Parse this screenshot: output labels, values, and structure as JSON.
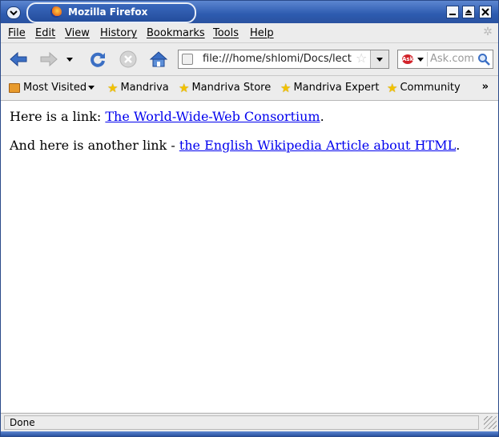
{
  "window": {
    "title": "Mozilla Firefox",
    "accent_color": "#2d5bb0"
  },
  "window_buttons": {
    "minimize_icon": "minimize-icon",
    "maximize_icon": "maximize-icon",
    "close_icon": "close-icon"
  },
  "menubar": {
    "items": [
      {
        "label": "File"
      },
      {
        "label": "Edit"
      },
      {
        "label": "View"
      },
      {
        "label": "History"
      },
      {
        "label": "Bookmarks"
      },
      {
        "label": "Tools"
      },
      {
        "label": "Help"
      }
    ]
  },
  "navbar": {
    "url": "file:///home/shlomi/Docs/lecture",
    "search_placeholder": "Ask.com",
    "search_engine_logo": "Ask"
  },
  "bookmarks": {
    "most_visited": "Most Visited",
    "items": [
      {
        "label": "Mandriva"
      },
      {
        "label": "Mandriva Store"
      },
      {
        "label": "Mandriva Expert"
      },
      {
        "label": "Community"
      }
    ],
    "overflow": "»"
  },
  "content": {
    "line1_prefix": "Here is a link: ",
    "link1": "The World-Wide-Web Consortium",
    "line1_suffix": ".",
    "line2_prefix": "And here is another link - ",
    "link2": "the English Wikipedia Article about HTML",
    "line2_suffix": ".",
    "link_color": "#0000ee"
  },
  "status": {
    "text": "Done"
  }
}
